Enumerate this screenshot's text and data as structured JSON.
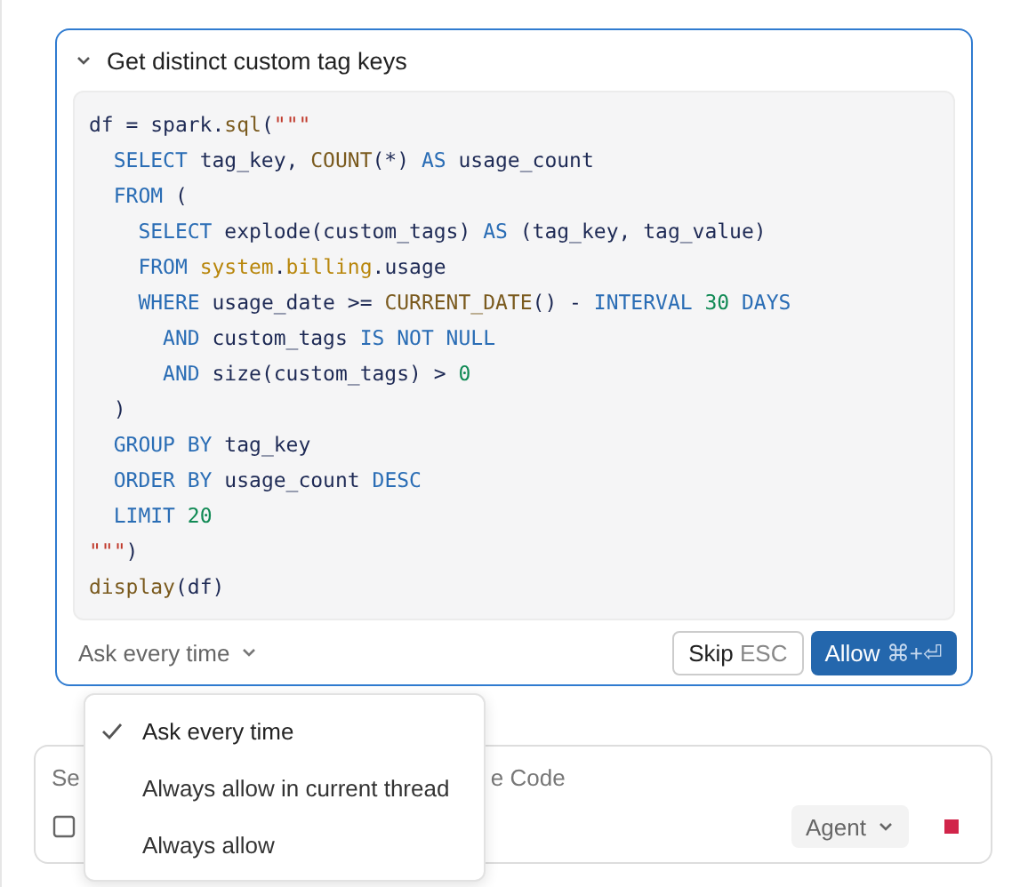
{
  "tool_call": {
    "title": "Get distinct custom tag keys",
    "expanded": true,
    "code_lines": [
      [
        {
          "kind": "plain",
          "text": "df = spark."
        },
        {
          "kind": "fn",
          "text": "sql"
        },
        {
          "kind": "plain",
          "text": "("
        },
        {
          "kind": "str",
          "text": "\"\"\""
        }
      ],
      [
        {
          "kind": "kw",
          "text": "  SELECT "
        },
        {
          "kind": "plain",
          "text": "tag_key, "
        },
        {
          "kind": "fn",
          "text": "COUNT"
        },
        {
          "kind": "plain",
          "text": "(*) "
        },
        {
          "kind": "kw",
          "text": "AS "
        },
        {
          "kind": "plain",
          "text": "usage_count"
        }
      ],
      [
        {
          "kind": "kw",
          "text": "  FROM "
        },
        {
          "kind": "plain",
          "text": "("
        }
      ],
      [
        {
          "kind": "kw",
          "text": "    SELECT "
        },
        {
          "kind": "plain",
          "text": "explode(custom_tags) "
        },
        {
          "kind": "kw",
          "text": "AS "
        },
        {
          "kind": "plain",
          "text": "(tag_key, tag_value)"
        }
      ],
      [
        {
          "kind": "kw",
          "text": "    FROM "
        },
        {
          "kind": "table",
          "text": "system"
        },
        {
          "kind": "plain",
          "text": "."
        },
        {
          "kind": "table",
          "text": "billing"
        },
        {
          "kind": "plain",
          "text": ".usage"
        }
      ],
      [
        {
          "kind": "kw",
          "text": "    WHERE "
        },
        {
          "kind": "plain",
          "text": "usage_date >= "
        },
        {
          "kind": "fn",
          "text": "CURRENT_DATE"
        },
        {
          "kind": "plain",
          "text": "() - "
        },
        {
          "kind": "kw",
          "text": "INTERVAL "
        },
        {
          "kind": "num",
          "text": "30 "
        },
        {
          "kind": "kw",
          "text": "DAYS"
        }
      ],
      [
        {
          "kind": "kw",
          "text": "      AND "
        },
        {
          "kind": "plain",
          "text": "custom_tags "
        },
        {
          "kind": "kw",
          "text": "IS NOT NULL"
        }
      ],
      [
        {
          "kind": "kw",
          "text": "      AND "
        },
        {
          "kind": "plain",
          "text": "size(custom_tags) > "
        },
        {
          "kind": "num",
          "text": "0"
        }
      ],
      [
        {
          "kind": "plain",
          "text": "  )"
        }
      ],
      [
        {
          "kind": "kw",
          "text": "  GROUP BY "
        },
        {
          "kind": "plain",
          "text": "tag_key"
        }
      ],
      [
        {
          "kind": "kw",
          "text": "  ORDER BY "
        },
        {
          "kind": "plain",
          "text": "usage_count "
        },
        {
          "kind": "kw",
          "text": "DESC"
        }
      ],
      [
        {
          "kind": "kw",
          "text": "  LIMIT "
        },
        {
          "kind": "num",
          "text": "20"
        }
      ],
      [
        {
          "kind": "str",
          "text": "\"\"\""
        },
        {
          "kind": "plain",
          "text": ")"
        }
      ],
      [
        {
          "kind": "fn",
          "text": "display"
        },
        {
          "kind": "plain",
          "text": "(df)"
        }
      ]
    ],
    "permission_select": "Ask every time",
    "skip_button": {
      "label": "Skip",
      "shortcut": "ESC"
    },
    "allow_button": {
      "label": "Allow",
      "shortcut": "⌘+⏎"
    }
  },
  "permission_menu": [
    {
      "label": "Ask every time",
      "selected": true
    },
    {
      "label": "Always allow in current thread",
      "selected": false
    },
    {
      "label": "Always allow",
      "selected": false
    }
  ],
  "composer": {
    "placeholder_start": "Se",
    "placeholder_end": "e Code",
    "mode": "Agent"
  }
}
